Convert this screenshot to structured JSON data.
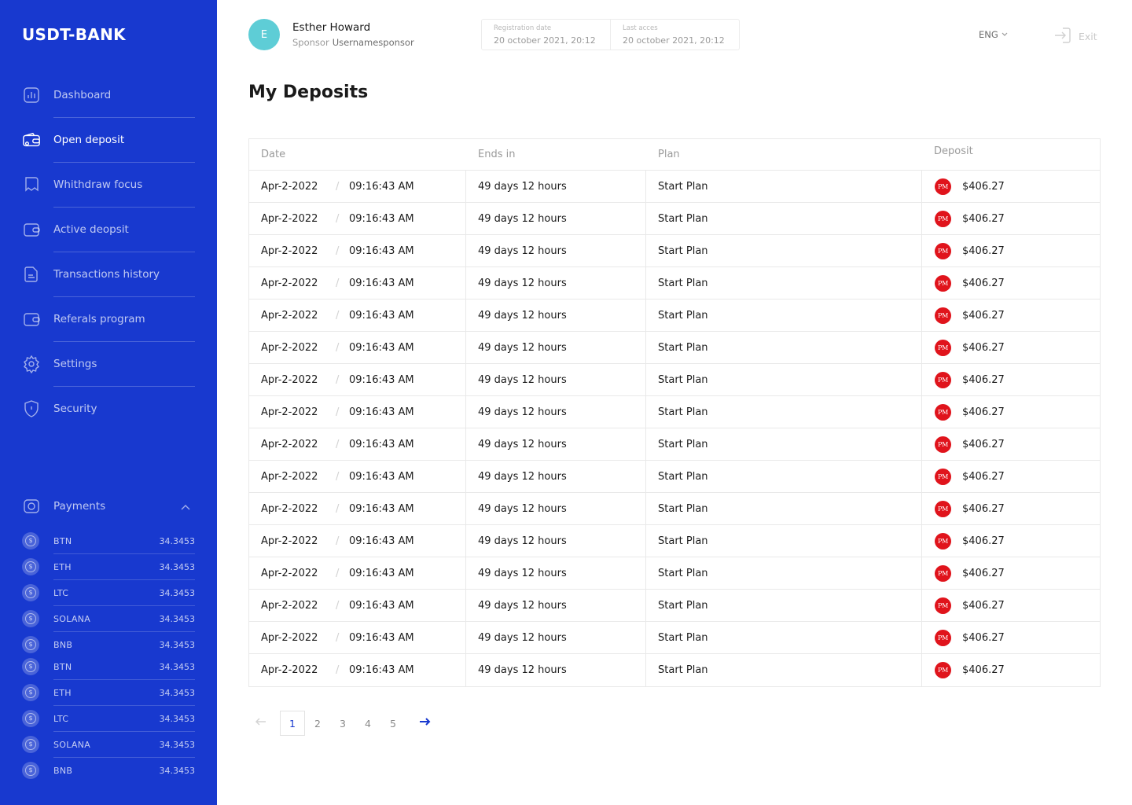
{
  "app": {
    "title": "USDT-BANK"
  },
  "sidebar": {
    "items": [
      {
        "label": "Dashboard",
        "icon": "chart-icon",
        "active": false
      },
      {
        "label": "Open deposit",
        "icon": "wallet-card-icon",
        "active": true
      },
      {
        "label": "Whithdraw focus",
        "icon": "withdraw-icon",
        "active": false
      },
      {
        "label": "Active deopsit",
        "icon": "wallet-icon",
        "active": false
      },
      {
        "label": "Transactions history",
        "icon": "document-icon",
        "active": false
      },
      {
        "label": "Referals program",
        "icon": "wallet-icon",
        "active": false
      },
      {
        "label": "Settings",
        "icon": "gear-icon",
        "active": false
      },
      {
        "label": "Security",
        "icon": "shield-icon",
        "active": false
      }
    ],
    "payments": {
      "label": "Payments",
      "items": [
        {
          "name": "BTN",
          "value": "34.3453"
        },
        {
          "name": "ETH",
          "value": "34.3453"
        },
        {
          "name": "LTC",
          "value": "34.3453"
        },
        {
          "name": "SOLANA",
          "value": "34.3453"
        },
        {
          "name": "BNB",
          "value": "34.3453"
        },
        {
          "name": "BTN",
          "value": "34.3453"
        },
        {
          "name": "ETH",
          "value": "34.3453"
        },
        {
          "name": "LTC",
          "value": "34.3453"
        },
        {
          "name": "SOLANA",
          "value": "34.3453"
        },
        {
          "name": "BNB",
          "value": "34.3453"
        }
      ]
    }
  },
  "header": {
    "avatar_initial": "E",
    "user_name": "Esther Howard",
    "sponsor_label": "Sponsor",
    "sponsor_user": "Usernamesponsor",
    "registration_label": "Registration date",
    "registration_value": "20 october 2021, 20:12",
    "last_access_label": "Last acces",
    "last_access_value": "20 october 2021, 20:12",
    "language": "ENG",
    "exit_label": "Exit"
  },
  "page": {
    "title": "My Deposits"
  },
  "table": {
    "columns": [
      "Date",
      "Ends in",
      "Plan",
      "Deposit"
    ],
    "payment_badge": "PM",
    "rows": [
      {
        "date": "Apr-2-2022",
        "time": "09:16:43 AM",
        "ends_in": "49 days 12 hours",
        "plan": "Start Plan",
        "deposit": "$406.27"
      },
      {
        "date": "Apr-2-2022",
        "time": "09:16:43 AM",
        "ends_in": "49 days 12 hours",
        "plan": "Start Plan",
        "deposit": "$406.27"
      },
      {
        "date": "Apr-2-2022",
        "time": "09:16:43 AM",
        "ends_in": "49 days 12 hours",
        "plan": "Start Plan",
        "deposit": "$406.27"
      },
      {
        "date": "Apr-2-2022",
        "time": "09:16:43 AM",
        "ends_in": "49 days 12 hours",
        "plan": "Start Plan",
        "deposit": "$406.27"
      },
      {
        "date": "Apr-2-2022",
        "time": "09:16:43 AM",
        "ends_in": "49 days 12 hours",
        "plan": "Start Plan",
        "deposit": "$406.27"
      },
      {
        "date": "Apr-2-2022",
        "time": "09:16:43 AM",
        "ends_in": "49 days 12 hours",
        "plan": "Start Plan",
        "deposit": "$406.27"
      },
      {
        "date": "Apr-2-2022",
        "time": "09:16:43 AM",
        "ends_in": "49 days 12 hours",
        "plan": "Start Plan",
        "deposit": "$406.27"
      },
      {
        "date": "Apr-2-2022",
        "time": "09:16:43 AM",
        "ends_in": "49 days 12 hours",
        "plan": "Start Plan",
        "deposit": "$406.27"
      },
      {
        "date": "Apr-2-2022",
        "time": "09:16:43 AM",
        "ends_in": "49 days 12 hours",
        "plan": "Start Plan",
        "deposit": "$406.27"
      },
      {
        "date": "Apr-2-2022",
        "time": "09:16:43 AM",
        "ends_in": "49 days 12 hours",
        "plan": "Start Plan",
        "deposit": "$406.27"
      },
      {
        "date": "Apr-2-2022",
        "time": "09:16:43 AM",
        "ends_in": "49 days 12 hours",
        "plan": "Start Plan",
        "deposit": "$406.27"
      },
      {
        "date": "Apr-2-2022",
        "time": "09:16:43 AM",
        "ends_in": "49 days 12 hours",
        "plan": "Start Plan",
        "deposit": "$406.27"
      },
      {
        "date": "Apr-2-2022",
        "time": "09:16:43 AM",
        "ends_in": "49 days 12 hours",
        "plan": "Start Plan",
        "deposit": "$406.27"
      },
      {
        "date": "Apr-2-2022",
        "time": "09:16:43 AM",
        "ends_in": "49 days 12 hours",
        "plan": "Start Plan",
        "deposit": "$406.27"
      },
      {
        "date": "Apr-2-2022",
        "time": "09:16:43 AM",
        "ends_in": "49 days 12 hours",
        "plan": "Start Plan",
        "deposit": "$406.27"
      },
      {
        "date": "Apr-2-2022",
        "time": "09:16:43 AM",
        "ends_in": "49 days 12 hours",
        "plan": "Start Plan",
        "deposit": "$406.27"
      }
    ]
  },
  "pagination": {
    "pages": [
      "1",
      "2",
      "3",
      "4",
      "5"
    ],
    "current": "1"
  },
  "colors": {
    "sidebar_bg": "#1839cf",
    "accent": "#1839cf",
    "avatar_bg": "#5ecdd6",
    "pm_badge": "#e0141c"
  }
}
